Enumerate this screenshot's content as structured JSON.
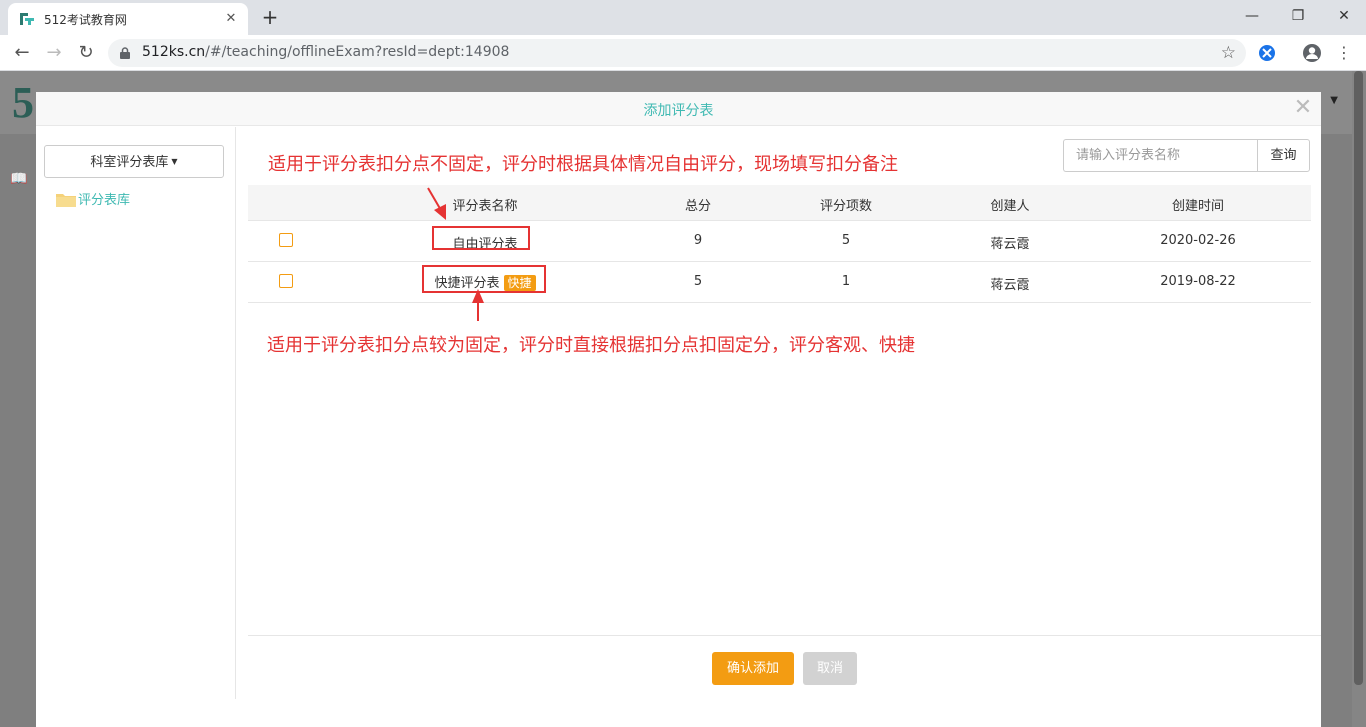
{
  "browser": {
    "tab_title": "512考试教育网",
    "url_host": "512ks.cn",
    "url_path": "/#/teaching/offlineExam?resId=dept:14908"
  },
  "modal": {
    "title": "添加评分表",
    "library_dropdown_label": "科室评分表库",
    "folder_label": "评分表库",
    "search_placeholder": "请输入评分表名称",
    "search_button": "查询",
    "columns": [
      "评分表名称",
      "总分",
      "评分项数",
      "创建人",
      "创建时间"
    ],
    "rows": [
      {
        "name": "自由评分表",
        "badge": "",
        "total": "9",
        "items": "5",
        "creator": "蒋云霞",
        "created": "2020-02-26"
      },
      {
        "name": "快捷评分表",
        "badge": "快捷",
        "total": "5",
        "items": "1",
        "creator": "蒋云霞",
        "created": "2019-08-22"
      }
    ],
    "confirm_button": "确认添加",
    "cancel_button": "取消"
  },
  "annotations": {
    "free_note": "适用于评分表扣分点不固定，评分时根据具体情况自由评分，现场填写扣分备注",
    "fast_note": "适用于评分表扣分点较为固定，评分时直接根据扣分点扣固定分，评分客观、快捷"
  },
  "colors": {
    "accent_teal": "#3fb9b2",
    "accent_orange": "#f39c12",
    "annotation_red": "#e53333"
  }
}
